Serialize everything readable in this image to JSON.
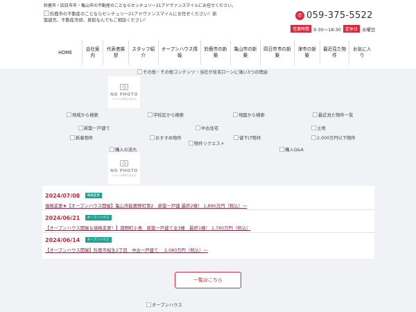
{
  "header": {
    "topline": "鈴鹿市・四日市市・亀山市の不動産のことならセンチュリー21アドヴァンスマイルにお任せください。",
    "logo_alt": "鈴鹿市の不動産のことならセンチュリー21アドヴァンスマイルにお任せください！新築建売、不動産売却、買取なんでもご相談ください！",
    "phone": "059-375-5522",
    "hours_tag": "営業時間",
    "hours": "9:30～18:30",
    "holiday_tag": "定休日",
    "holiday": "水曜日"
  },
  "nav": [
    "HOME",
    "会社案内",
    "代表者挨拶",
    "スタッフ紹介",
    "オープンハウス情報",
    "鈴鹿市の新築",
    "亀山市の新築",
    "四日市市の新築",
    "津市の新築",
    "最近見た物件",
    "お気に入り"
  ],
  "banner_alt": "その他・その他コンテンツ・当社が住宅ローンに強い3つの理由",
  "nophoto": {
    "title": "NO PHOTO",
    "sub": "イメージがありません"
  },
  "search_links": {
    "area": "地域から検索",
    "school": "学校区から検索",
    "map": "地図から検索",
    "recent": "最近見た物件一覧",
    "new_house": "新築一戸建て",
    "used_house": "中古住宅",
    "land": "土地",
    "new_arrival": "新着物件",
    "recommended": "おすすめ物件",
    "price_down": "値下げ物件",
    "under20m": "2,000万円以下物件",
    "request": "物件リクエスト",
    "flow": "購入の流れ",
    "qa": "購入Q&A"
  },
  "news": [
    {
      "date": "2024/07/08",
      "category": "価格変更",
      "title": "価格変更★【オープンハウス開催】亀山市能褒野町第2　新築一戸建 最終2棟！ 1,890万円（税込）～"
    },
    {
      "date": "2024/06/21",
      "category": "オープンハウス",
      "title": "【オープンハウス開催＆価格変更！】菰野町小島　新築一戸建て全3棟　最終1棟！ 1,780万円（税込）"
    },
    {
      "date": "2024/06/14",
      "category": "オープンハウス",
      "title": "【オープンハウス開催】鈴鹿市桜生2丁目　中古一戸建て　 2,080万円（税込）～"
    }
  ],
  "list_button": "一覧はこちら",
  "bottom_alt": "オープンハウス",
  "colors": {
    "accent": "#d8283b",
    "badge": "#1fa18f",
    "band": "#f0f2f6"
  }
}
